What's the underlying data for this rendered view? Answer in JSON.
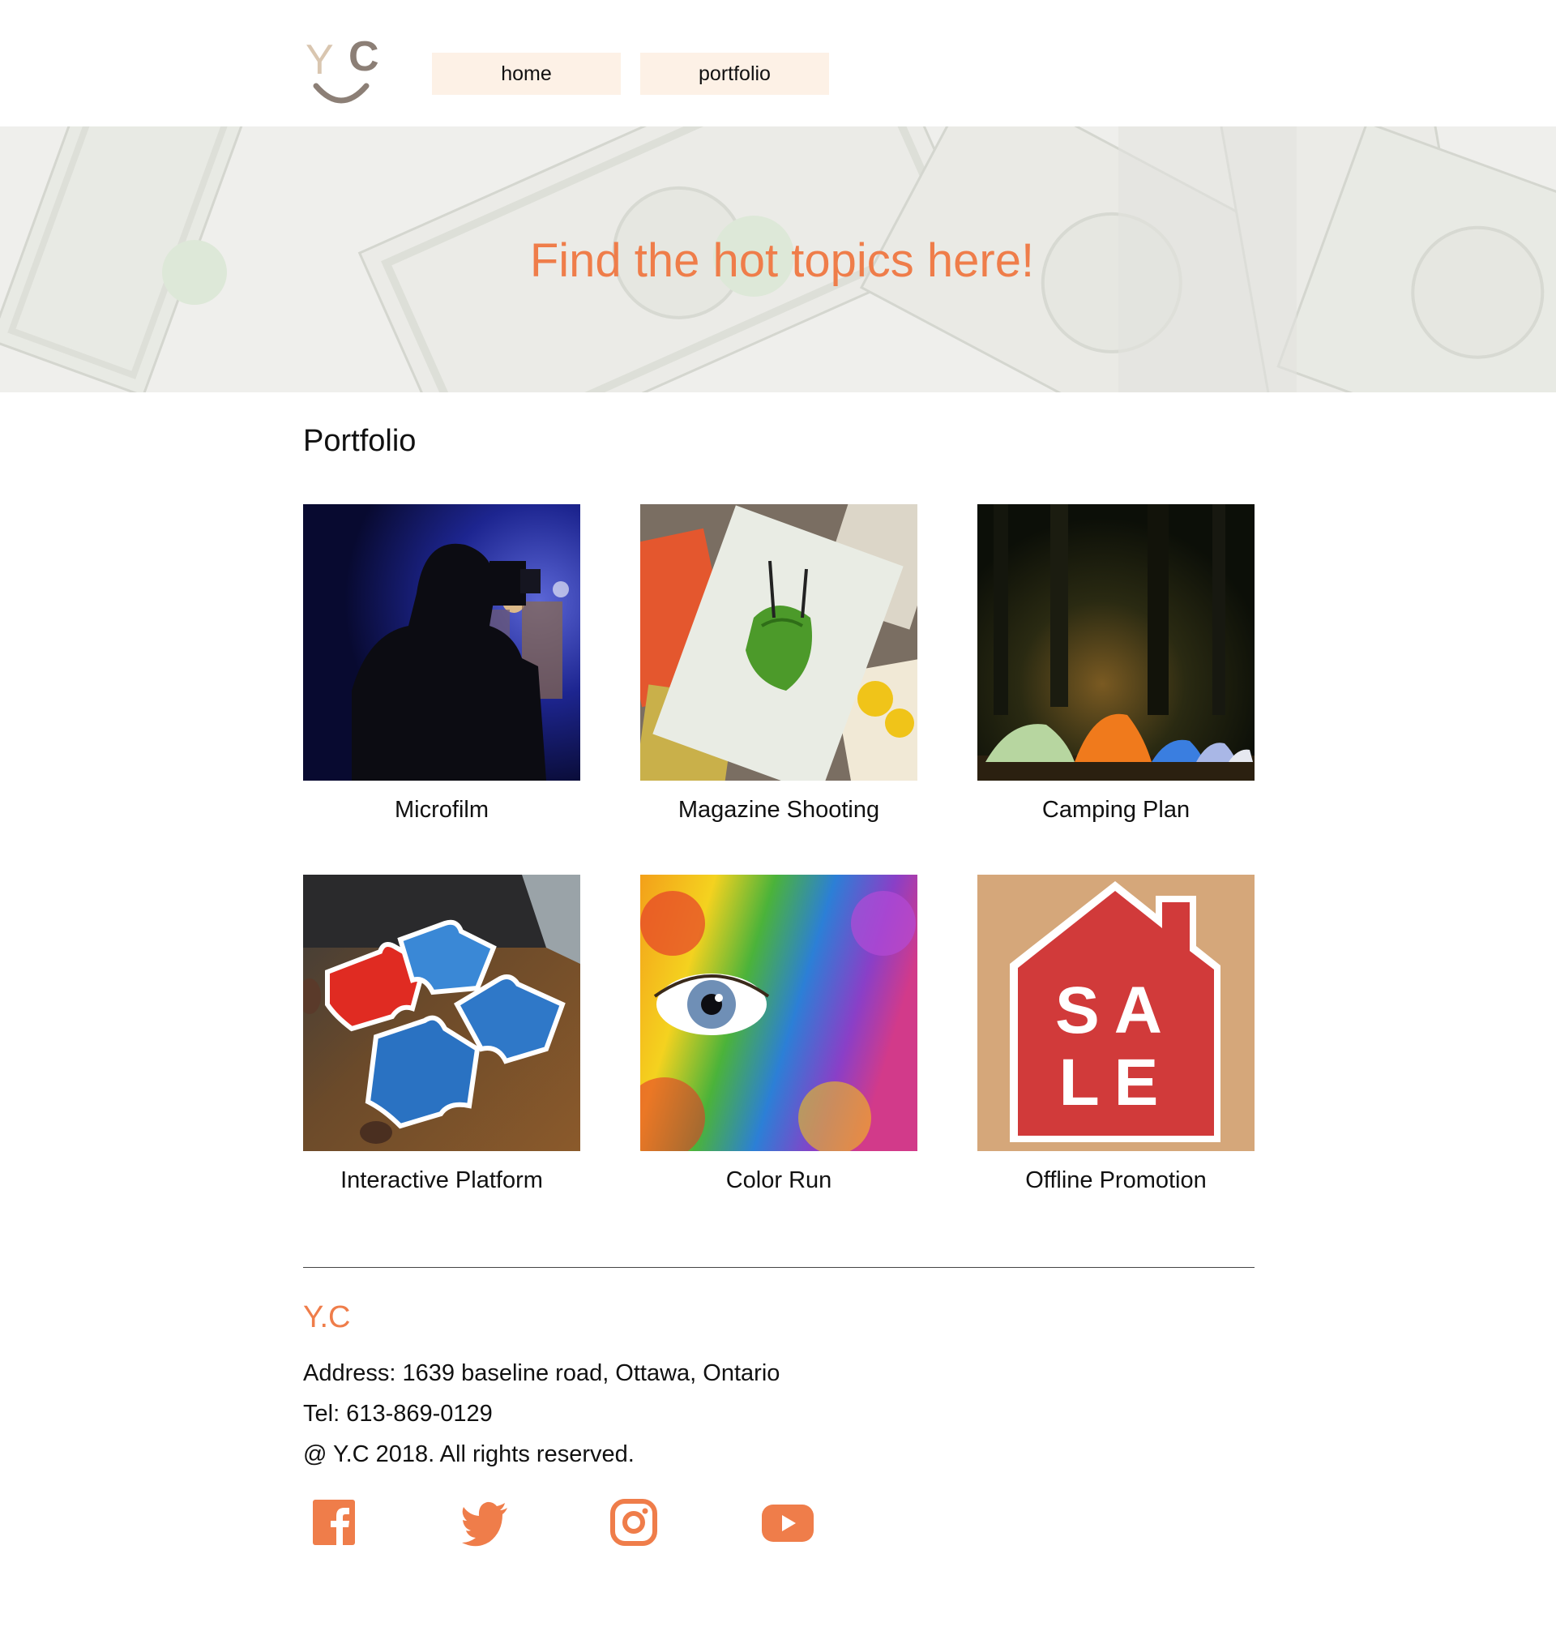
{
  "header": {
    "logo_letters": [
      "Y",
      "C"
    ],
    "nav": [
      {
        "label": "home"
      },
      {
        "label": "portfolio"
      }
    ]
  },
  "hero": {
    "title": "Find the hot topics here!"
  },
  "portfolio": {
    "title": "Portfolio",
    "items": [
      {
        "caption": "Microfilm",
        "image": "camera-operator-silhouette"
      },
      {
        "caption": "Magazine Shooting",
        "image": "stack-of-magazines"
      },
      {
        "caption": "Camping Plan",
        "image": "tents-in-forest-at-night"
      },
      {
        "caption": "Interactive Platform",
        "image": "hands-holding-puzzle-pieces"
      },
      {
        "caption": "Color Run",
        "image": "rainbow-painted-face-eye"
      },
      {
        "caption": "Offline Promotion",
        "image": "red-house-sale-sign"
      }
    ]
  },
  "footer": {
    "brand": "Y.C",
    "address": "Address: 1639 baseline road, Ottawa, Ontario",
    "tel": "Tel: 613-869-0129",
    "copyright": "@ Y.C 2018. All rights reserved.",
    "social": [
      "facebook-icon",
      "twitter-icon",
      "instagram-icon",
      "youtube-icon"
    ]
  },
  "colors": {
    "accent": "#ef7d4a",
    "nav_bg": "#fdf1e6",
    "text": "#111111",
    "logo_light": "#d9c6b0",
    "logo_dark": "#8c7f76"
  }
}
